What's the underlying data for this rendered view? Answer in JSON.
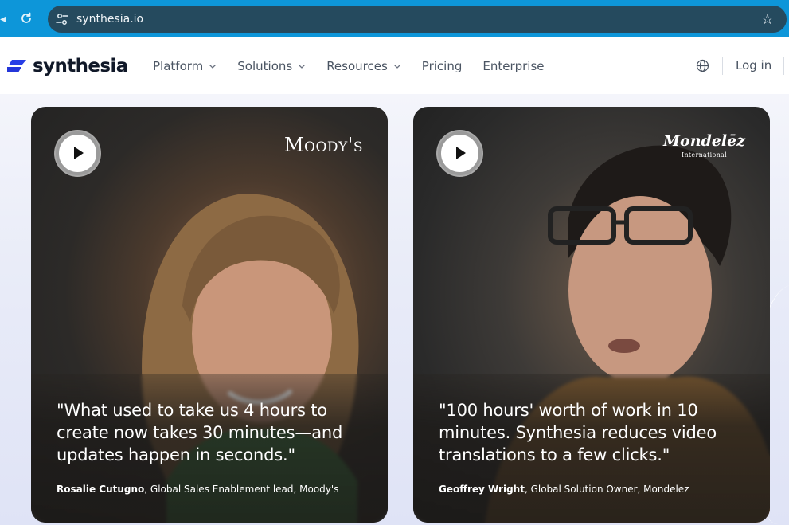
{
  "browser": {
    "url": "synthesia.io",
    "icons": {
      "reload": "reload-icon",
      "site_info": "tune-icon",
      "bookmark": "star-icon"
    }
  },
  "site": {
    "logo_text": "synthesia",
    "nav": [
      {
        "label": "Platform",
        "has_dropdown": true
      },
      {
        "label": "Solutions",
        "has_dropdown": true
      },
      {
        "label": "Resources",
        "has_dropdown": true
      },
      {
        "label": "Pricing",
        "has_dropdown": false
      },
      {
        "label": "Enterprise",
        "has_dropdown": false
      }
    ],
    "login_label": "Log in",
    "accent_color": "#1f3bd6"
  },
  "cards": [
    {
      "brand": "Moody's",
      "quote": "\"What used to take us 4 hours to create now takes 30 minutes—and updates happen in seconds.\"",
      "author": "Rosalie Cutugno",
      "role": ", Global Sales Enablement lead, Moody's"
    },
    {
      "brand": "Mondelēz",
      "brand_sub": "International",
      "quote": "\"100 hours' worth of work in 10 minutes. Synthesia reduces video translations to a few clicks.\"",
      "author": "Geoffrey Wright",
      "role": ", Global Solution Owner, Mondelez"
    }
  ]
}
